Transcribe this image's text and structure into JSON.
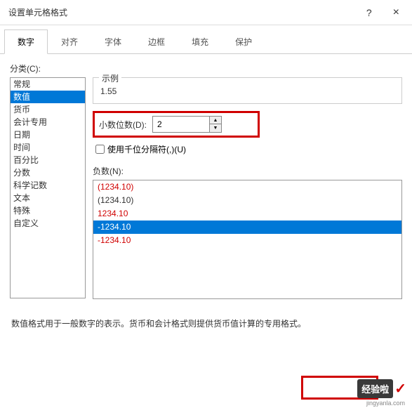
{
  "titlebar": {
    "title": "设置单元格格式",
    "help": "?",
    "close": "×"
  },
  "tabs": [
    {
      "label": "数字",
      "active": true
    },
    {
      "label": "对齐",
      "active": false
    },
    {
      "label": "字体",
      "active": false
    },
    {
      "label": "边框",
      "active": false
    },
    {
      "label": "填充",
      "active": false
    },
    {
      "label": "保护",
      "active": false
    }
  ],
  "category": {
    "label": "分类(C):",
    "items": [
      {
        "label": "常规",
        "selected": false
      },
      {
        "label": "数值",
        "selected": true
      },
      {
        "label": "货币",
        "selected": false
      },
      {
        "label": "会计专用",
        "selected": false
      },
      {
        "label": "日期",
        "selected": false
      },
      {
        "label": "时间",
        "selected": false
      },
      {
        "label": "百分比",
        "selected": false
      },
      {
        "label": "分数",
        "selected": false
      },
      {
        "label": "科学记数",
        "selected": false
      },
      {
        "label": "文本",
        "selected": false
      },
      {
        "label": "特殊",
        "selected": false
      },
      {
        "label": "自定义",
        "selected": false
      }
    ]
  },
  "example": {
    "label": "示例",
    "value": "1.55"
  },
  "decimal": {
    "label": "小数位数(D):",
    "value": "2"
  },
  "thousand": {
    "label": "使用千位分隔符(,)(U)"
  },
  "negative": {
    "label": "负数(N):",
    "items": [
      {
        "label": "(1234.10)",
        "cls": "neg-red",
        "selected": false
      },
      {
        "label": "(1234.10)",
        "cls": "neg-black",
        "selected": false
      },
      {
        "label": "1234.10",
        "cls": "neg-red",
        "selected": false
      },
      {
        "label": "-1234.10",
        "cls": "neg-black",
        "selected": true
      },
      {
        "label": "-1234.10",
        "cls": "neg-red",
        "selected": false
      }
    ]
  },
  "description": "数值格式用于一般数字的表示。货币和会计格式则提供货币值计算的专用格式。",
  "watermark": {
    "text": "经验啦",
    "url": "jingyanla.com"
  }
}
